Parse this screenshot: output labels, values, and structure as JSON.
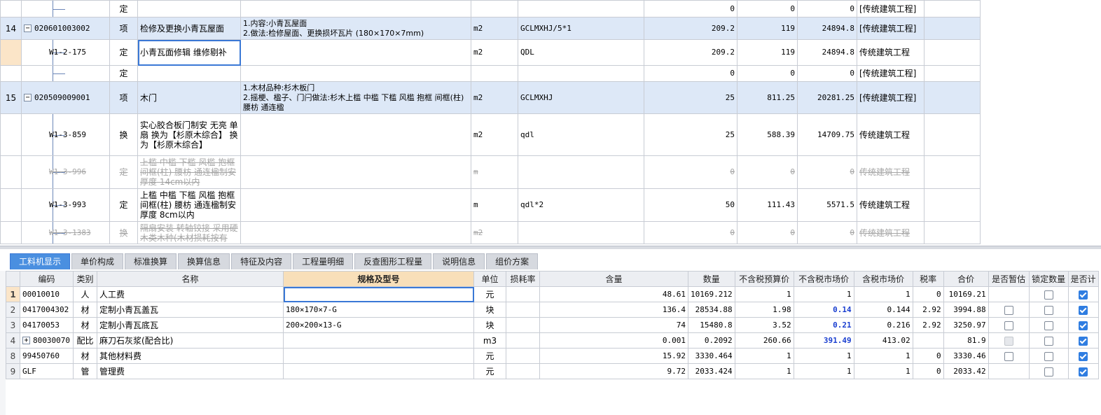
{
  "upper_rows": [
    {
      "kind": "sub",
      "num": "",
      "code": "",
      "type": "定",
      "name": "",
      "desc": "",
      "unit": "",
      "expr": "",
      "qty": "0",
      "price": "0",
      "total": "0",
      "cat": "[传统建筑工程]",
      "struck": false
    },
    {
      "kind": "item",
      "num": "14",
      "code": "020601003002",
      "type": "项",
      "name": "检修及更换小青瓦屋面",
      "desc": "1.内容:小青瓦屋面\n2.做法:检修屋面、更换损坏瓦片 (180×170×7mm)",
      "unit": "m2",
      "expr": "GCLMXHJ/5*1",
      "qty": "209.2",
      "price": "119",
      "total": "24894.8",
      "cat": "[传统建筑工程]",
      "struck": false
    },
    {
      "kind": "sub",
      "num": "",
      "code": "W1-2-175",
      "type": "定",
      "name": "小青瓦面修辑 维修剔补",
      "desc": "",
      "unit": "m2",
      "expr": "QDL",
      "qty": "209.2",
      "price": "119",
      "total": "24894.8",
      "cat": "传统建筑工程",
      "struck": false,
      "editing": true
    },
    {
      "kind": "sub",
      "num": "",
      "code": "",
      "type": "定",
      "name": "",
      "desc": "",
      "unit": "",
      "expr": "",
      "qty": "0",
      "price": "0",
      "total": "0",
      "cat": "[传统建筑工程]",
      "struck": false
    },
    {
      "kind": "item",
      "num": "15",
      "code": "020509009001",
      "type": "项",
      "name": "木门",
      "desc": "1.木材品种:杉木板门\n2.摇梗、楹子、门闩做法:杉木上槛 中槛 下槛 风槛 抱框 间框(柱) 腰枋 通连楹",
      "unit": "m2",
      "expr": "GCLMXHJ",
      "qty": "25",
      "price": "811.25",
      "total": "20281.25",
      "cat": "[传统建筑工程]",
      "struck": false
    },
    {
      "kind": "sub",
      "num": "",
      "code": "W1-3-859",
      "type": "换",
      "name": "实心胶合板门制安 无亮 单扇  换为【杉原木综合】  换为【杉原木综合】",
      "desc": "",
      "unit": "m2",
      "expr": "qdl",
      "qty": "25",
      "price": "588.39",
      "total": "14709.75",
      "cat": "传统建筑工程",
      "struck": false
    },
    {
      "kind": "sub",
      "num": "",
      "code": "W1-3-996",
      "type": "定",
      "name": "上槛 中槛 下槛 风槛 抱框 间框(柱) 腰枋 通连楹制安 厚度 14cm以内",
      "desc": "",
      "unit": "m",
      "expr": "",
      "qty": "0",
      "price": "0",
      "total": "0",
      "cat": "传统建筑工程",
      "struck": true
    },
    {
      "kind": "sub",
      "num": "",
      "code": "W1-3-993",
      "type": "定",
      "name": "上槛 中槛 下槛 风槛 抱框 间框(柱) 腰枋 通连楹制安 厚度 8cm以内",
      "desc": "",
      "unit": "m",
      "expr": "qdl*2",
      "qty": "50",
      "price": "111.43",
      "total": "5571.5",
      "cat": "传统建筑工程",
      "struck": false
    },
    {
      "kind": "sub",
      "num": "",
      "code": "W1-3-1383",
      "type": "换",
      "name": "隔扇安装 转轴铰接 采用硬木类木种(木材损耗按有",
      "desc": "",
      "unit": "m2",
      "expr": "",
      "qty": "0",
      "price": "0",
      "total": "0",
      "cat": "传统建筑工程",
      "struck": true
    }
  ],
  "tabs": [
    "工料机显示",
    "单价构成",
    "标准换算",
    "换算信息",
    "特征及内容",
    "工程量明细",
    "反查图形工程量",
    "说明信息",
    "组价方案"
  ],
  "active_tab": 0,
  "lower_headers": [
    "编码",
    "类别",
    "名称",
    "规格及型号",
    "单位",
    "损耗率",
    "含量",
    "数量",
    "不含税预算价",
    "不含税市场价",
    "含税市场价",
    "税率",
    "合价",
    "是否暂估",
    "锁定数量",
    "是否计"
  ],
  "lower_rows": [
    {
      "rn": "1",
      "code": "00010010",
      "cat": "人",
      "name": "人工费",
      "spec": "",
      "unit": "元",
      "loss": "",
      "content": "48.61",
      "qty": "10169.212",
      "budget": "1",
      "market": "1",
      "market_tax": "1",
      "rate": "0",
      "total": "10169.21",
      "est": "none",
      "lock": "off",
      "calc": "on",
      "expand": false,
      "blue": false
    },
    {
      "rn": "2",
      "code": "0417004302",
      "cat": "材",
      "name": "定制小青瓦盖瓦",
      "spec": "180×170×7-G",
      "unit": "块",
      "loss": "",
      "content": "136.4",
      "qty": "28534.88",
      "budget": "1.98",
      "market": "0.14",
      "market_tax": "0.144",
      "rate": "2.92",
      "total": "3994.88",
      "est": "off",
      "lock": "off",
      "calc": "on",
      "expand": false,
      "blue": true
    },
    {
      "rn": "3",
      "code": "04170053",
      "cat": "材",
      "name": "定制小青瓦底瓦",
      "spec": "200×200×13-G",
      "unit": "块",
      "loss": "",
      "content": "74",
      "qty": "15480.8",
      "budget": "3.52",
      "market": "0.21",
      "market_tax": "0.216",
      "rate": "2.92",
      "total": "3250.97",
      "est": "off",
      "lock": "off",
      "calc": "on",
      "expand": false,
      "blue": true
    },
    {
      "rn": "4",
      "code": "80030070",
      "cat": "配比",
      "name": "麻刀石灰浆(配合比)",
      "spec": "",
      "unit": "m3",
      "loss": "",
      "content": "0.001",
      "qty": "0.2092",
      "budget": "260.66",
      "market": "391.49",
      "market_tax": "413.02",
      "rate": "",
      "total": "81.9",
      "est": "dis",
      "lock": "off",
      "calc": "on",
      "expand": true,
      "blue": true
    },
    {
      "rn": "8",
      "code": "99450760",
      "cat": "材",
      "name": "其他材料费",
      "spec": "",
      "unit": "元",
      "loss": "",
      "content": "15.92",
      "qty": "3330.464",
      "budget": "1",
      "market": "1",
      "market_tax": "1",
      "rate": "0",
      "total": "3330.46",
      "est": "off",
      "lock": "off",
      "calc": "on",
      "expand": false,
      "blue": false
    },
    {
      "rn": "9",
      "code": "GLF",
      "cat": "管",
      "name": "管理费",
      "spec": "",
      "unit": "元",
      "loss": "",
      "content": "9.72",
      "qty": "2033.424",
      "budget": "1",
      "market": "1",
      "market_tax": "1",
      "rate": "0",
      "total": "2033.42",
      "est": "none",
      "lock": "off",
      "calc": "on",
      "expand": false,
      "blue": false
    }
  ],
  "expand_glyph": "−",
  "plus_glyph": "+",
  "colors": {
    "tab_active": "#4a8fe0",
    "item_row": "#dde8f7",
    "blue_value": "#1a3fd0",
    "check_on": "#2f7de1"
  }
}
